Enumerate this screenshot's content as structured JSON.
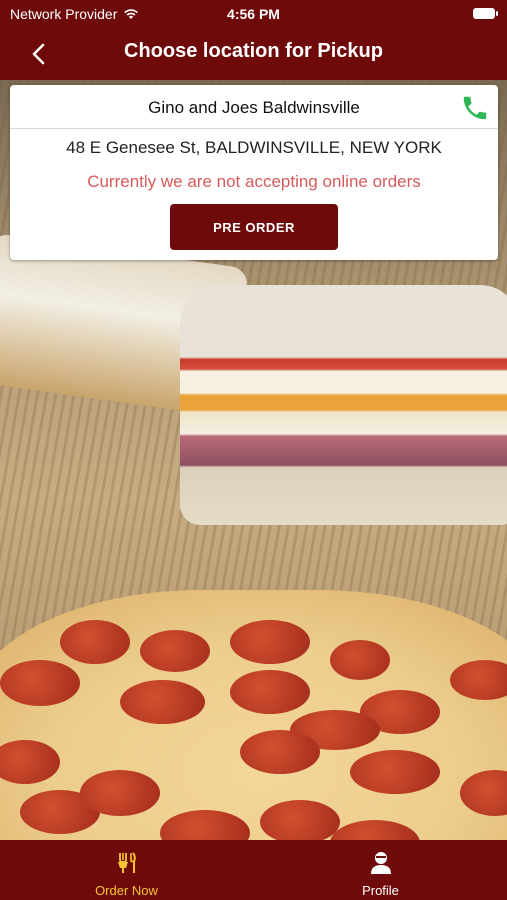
{
  "status_bar": {
    "carrier": "Network Provider",
    "time": "4:56 PM"
  },
  "nav": {
    "title": "Choose location for Pickup"
  },
  "location": {
    "name": "Gino and Joes Baldwinsville",
    "address": "48 E Genesee St, BALDWINSVILLE, NEW YORK",
    "notice": "Currently we are not accepting online orders",
    "preorder_label": "PRE ORDER"
  },
  "tabs": {
    "order_now": "Order Now",
    "profile": "Profile"
  },
  "colors": {
    "brand": "#6f0a0a",
    "active_tab": "#f6c432",
    "notice": "#d65a5a",
    "phone_icon": "#2fb657"
  }
}
